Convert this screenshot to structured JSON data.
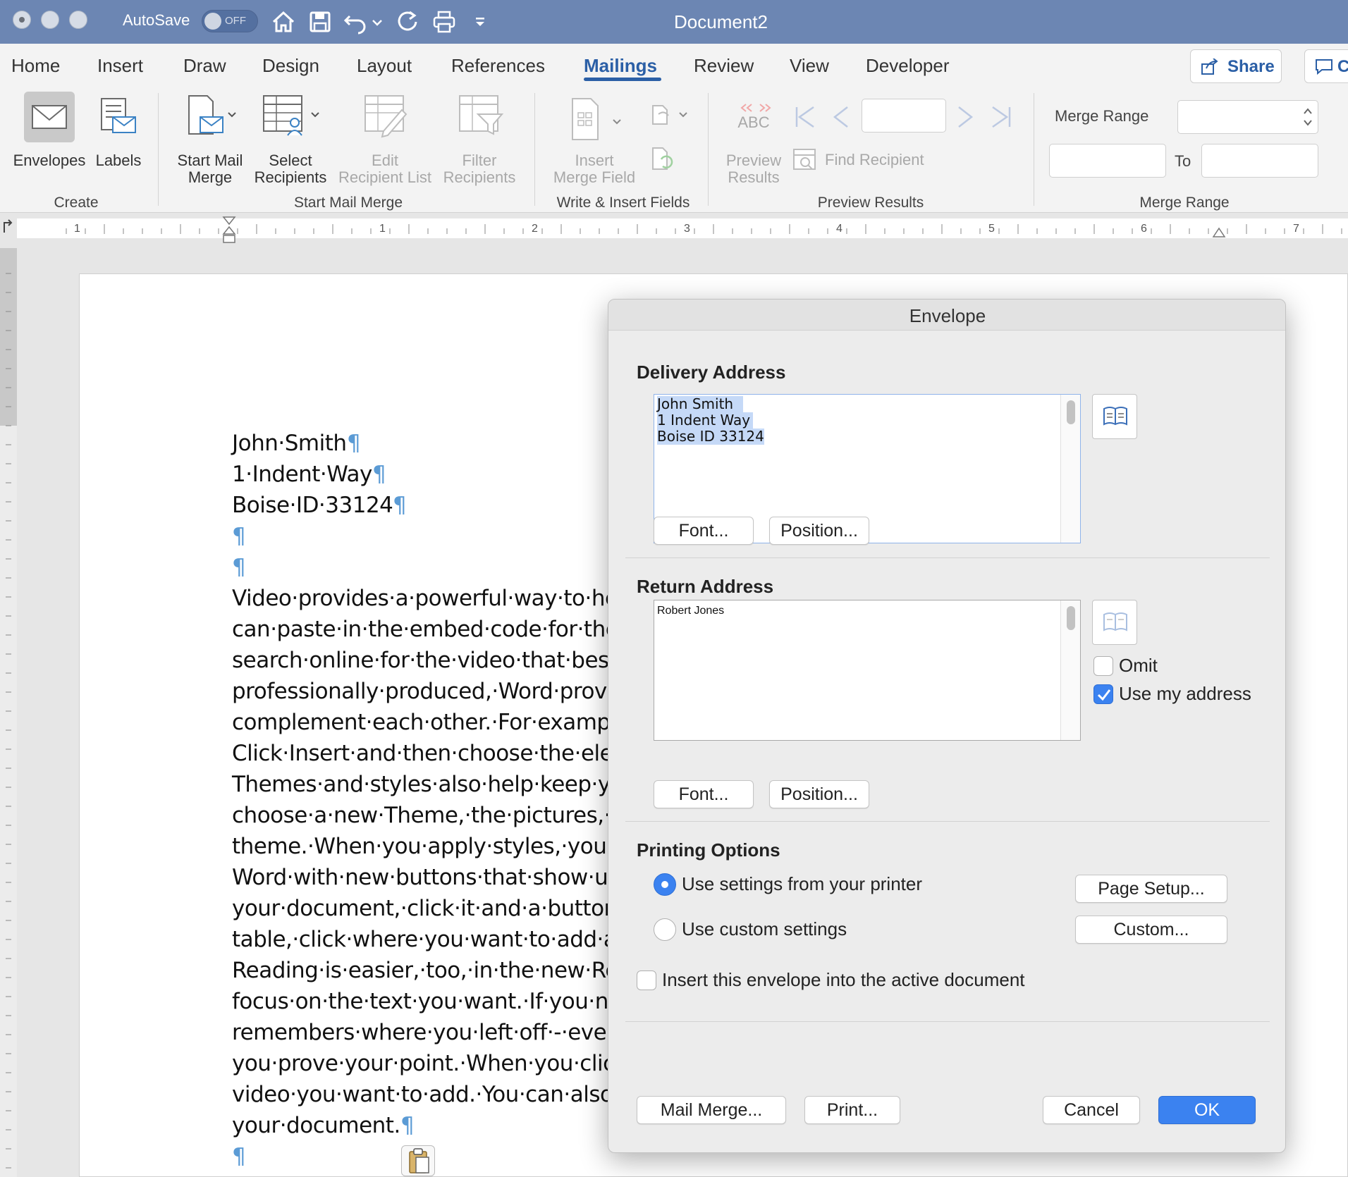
{
  "window": {
    "title": "Document2",
    "autosave_label": "AutoSave",
    "autosave_state": "OFF"
  },
  "tabs": [
    "Home",
    "Insert",
    "Draw",
    "Design",
    "Layout",
    "References",
    "Mailings",
    "Review",
    "View",
    "Developer"
  ],
  "active_tab": "Mailings",
  "share_label": "Share",
  "comments_label": "Co",
  "ribbon": {
    "envelopes": "Envelopes",
    "labels": "Labels",
    "start_mail_merge": [
      "Start Mail",
      "Merge"
    ],
    "select_recipients": [
      "Select",
      "Recipients"
    ],
    "edit_recipient_list": [
      "Edit",
      "Recipient List"
    ],
    "filter_recipients": [
      "Filter",
      "Recipients"
    ],
    "insert_merge_field": [
      "Insert",
      "Merge Field"
    ],
    "preview_abc": "ABC",
    "preview_results": [
      "Preview",
      "Results"
    ],
    "find_recipient": "Find Recipient",
    "merge_range_label": "Merge Range",
    "to_label": "To",
    "groups": {
      "create": "Create",
      "start_mail_merge": "Start Mail Merge",
      "write_insert": "Write & Insert Fields",
      "preview_results": "Preview Results",
      "merge_range": "Merge Range"
    }
  },
  "ruler_numbers": [
    "1",
    "1",
    "2",
    "3",
    "4",
    "5",
    "6",
    "7"
  ],
  "document": {
    "lines": [
      "John·Smith",
      "1·Indent·Way",
      "Boise·ID·33124",
      "",
      "",
      "Video·provides·a·powerful·way·to·he",
      "can·paste·in·the·embed·code·for·the·",
      "search·online·for·the·video·that·best",
      "professionally·produced,·Word·provi",
      "complement·each·other.·For·example",
      "Click·Insert·and·then·choose·the·elen",
      "Themes·and·styles·also·help·keep·you",
      "choose·a·new·Theme,·the·pictures,·c",
      "theme.·When·you·apply·styles,·your·",
      "Word·with·new·buttons·that·show·up",
      "your·document,·click·it·and·a·button",
      "table,·click·where·you·want·to·add·a·",
      "Reading·is·easier,·too,·in·the·new·Rea",
      "focus·on·the·text·you·want.·If·you·ne",
      "remembers·where·you·left·off·-·even",
      "you·prove·your·point.·When·you·click",
      "video·you·want·to·add.·You·can·also·",
      "your·document.",
      ""
    ],
    "pilcrow": "¶"
  },
  "dialog": {
    "title": "Envelope",
    "delivery_heading": "Delivery Address",
    "delivery_lines": [
      "John Smith",
      "1 Indent Way",
      "Boise ID 33124"
    ],
    "return_heading": "Return Address",
    "return_text": "Robert Jones",
    "font_button": "Font...",
    "position_button": "Position...",
    "omit_label": "Omit",
    "omit_checked": false,
    "use_my_address_label": "Use my address",
    "use_my_address_checked": true,
    "printing_heading": "Printing Options",
    "use_printer_settings": "Use settings from your printer",
    "use_custom_settings": "Use custom settings",
    "selected_printing_option": "Use settings from your printer",
    "page_setup_button": "Page Setup...",
    "custom_button": "Custom...",
    "insert_envelope_label": "Insert this envelope into the active document",
    "insert_envelope_checked": false,
    "mail_merge_button": "Mail Merge...",
    "print_button": "Print...",
    "cancel_button": "Cancel",
    "ok_button": "OK"
  },
  "colors": {
    "titlebar": "#6c86b3",
    "accent": "#3b82f0",
    "pilcrow": "#5b9bd5",
    "tab_underline": "#2b5fa6"
  }
}
